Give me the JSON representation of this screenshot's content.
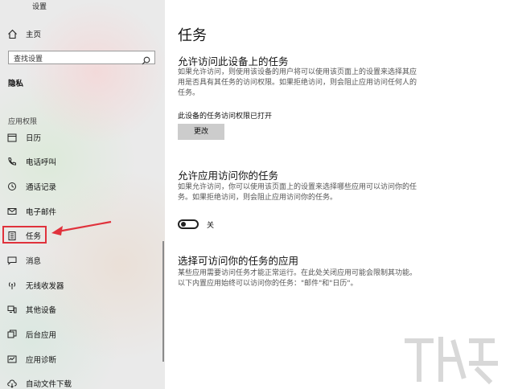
{
  "window": {
    "title": "设置"
  },
  "sidebar": {
    "home": "主页",
    "search_placeholder": "查找设置",
    "section": "隐私",
    "group": "应用权限",
    "items": [
      {
        "label": "日历",
        "icon": "calendar-icon"
      },
      {
        "label": "电话呼叫",
        "icon": "phone-icon"
      },
      {
        "label": "通话记录",
        "icon": "history-icon"
      },
      {
        "label": "电子邮件",
        "icon": "mail-icon"
      },
      {
        "label": "任务",
        "icon": "clipboard-icon",
        "selected": true
      },
      {
        "label": "消息",
        "icon": "message-icon"
      },
      {
        "label": "无线收发器",
        "icon": "radio-icon"
      },
      {
        "label": "其他设备",
        "icon": "devices-icon"
      },
      {
        "label": "后台应用",
        "icon": "background-apps-icon"
      },
      {
        "label": "应用诊断",
        "icon": "diagnostics-icon"
      },
      {
        "label": "自动文件下载",
        "icon": "cloud-download-icon"
      }
    ]
  },
  "main": {
    "title": "任务",
    "section1": {
      "heading": "允许访问此设备上的任务",
      "desc": "如果允许访问，则使用该设备的用户将可以使用该页面上的设置来选择其应用是否具有其任务的访问权限。如果拒绝访问，则会阻止应用访问任何人的任务。",
      "status": "此设备的任务访问权限已打开",
      "button": "更改"
    },
    "section2": {
      "heading": "允许应用访问你的任务",
      "desc": "如果允许访问，你可以使用该页面上的设置来选择哪些应用可以访问你的任务。如果拒绝访问，则会阻止应用访问你的任务。",
      "toggle_label": "关",
      "toggle_on": false
    },
    "section3": {
      "heading": "选择可访问你的任务的应用",
      "desc": "某些应用需要访问任务才能正常运行。在此处关闭应用可能会限制其功能。以下内置应用始终可以访问你的任务：\"邮件\"和\"日历\"。"
    }
  },
  "colors": {
    "highlight": "#e0323c",
    "sidebar_bg": "#eaeaea"
  }
}
